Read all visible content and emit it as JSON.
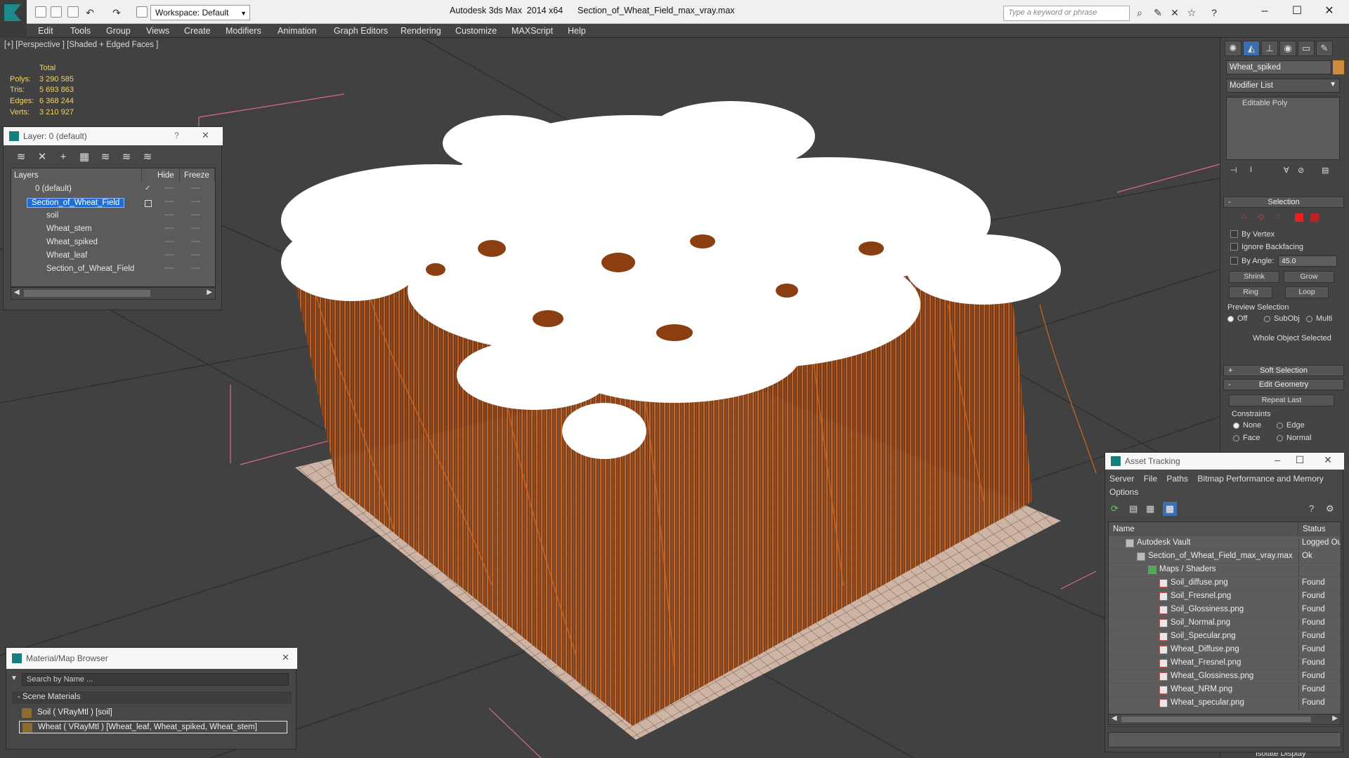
{
  "titlebar": {
    "workspace": "Workspace: Default",
    "title": "Autodesk 3ds Max  2014 x64      Section_of_Wheat_Field_max_vray.max",
    "search_placeholder": "Type a keyword or phrase"
  },
  "menu": [
    "Edit",
    "Tools",
    "Group",
    "Views",
    "Create",
    "Modifiers",
    "Animation",
    "Graph Editors",
    "Rendering",
    "Customize",
    "MAXScript",
    "Help"
  ],
  "viewport": {
    "label": "[+] [Perspective ] [Shaded + Edged Faces ]",
    "stats": {
      "total_label": "Total",
      "rows": [
        {
          "key": "Polys:",
          "value": "3 290 585"
        },
        {
          "key": "Tris:",
          "value": "5 693 863"
        },
        {
          "key": "Edges:",
          "value": "6 368 244"
        },
        {
          "key": "Verts:",
          "value": "3 210 927"
        }
      ]
    }
  },
  "layer_panel": {
    "title": "Layer: 0 (default)",
    "help": "?",
    "close": "✕",
    "columns": {
      "layers": "Layers",
      "hide": "Hide",
      "freeze": "Freeze"
    },
    "rows": [
      {
        "name": "0 (default)",
        "selected": false
      },
      {
        "name": "Section_of_Wheat_Field",
        "selected": true
      },
      {
        "name": "soil",
        "selected": false
      },
      {
        "name": "Wheat_stem",
        "selected": false
      },
      {
        "name": "Wheat_spiked",
        "selected": false
      },
      {
        "name": "Wheat_leaf",
        "selected": false
      },
      {
        "name": "Section_of_Wheat_Field",
        "selected": false
      }
    ],
    "dash": "----"
  },
  "material_browser": {
    "title": "Material/Map Browser",
    "search_placeholder": "Search by Name ...",
    "group": "- Scene Materials",
    "items": [
      {
        "label": "Soil  ( VRayMtl ) [soil]"
      },
      {
        "label": "Wheat  ( VRayMtl ) [Wheat_leaf, Wheat_spiked, Wheat_stem]"
      }
    ]
  },
  "command_panel": {
    "object_name": "Wheat_spiked",
    "modifier_list": "Modifier List",
    "stack_item": "Editable Poly",
    "selection": {
      "title": "Selection",
      "by_vertex": "By Vertex",
      "ignore_backfacing": "Ignore Backfacing",
      "by_angle": "By Angle:",
      "angle_value": "45.0",
      "shrink": "Shrink",
      "grow": "Grow",
      "ring": "Ring",
      "loop": "Loop",
      "preview_selection": "Preview Selection",
      "off": "Off",
      "subobj": "SubObj",
      "multi": "Multi",
      "status": "Whole Object Selected"
    },
    "soft_selection": "Soft Selection",
    "edit_geometry": "Edit Geometry",
    "repeat_last": "Repeat Last",
    "constraints": "Constraints",
    "none": "None",
    "edge": "Edge",
    "face": "Face",
    "normal": "Normal",
    "isolate": "Isolate Display"
  },
  "asset_tracking": {
    "title": "Asset Tracking",
    "menu": [
      "Server",
      "File",
      "Paths",
      "Bitmap Performance and Memory",
      "Options"
    ],
    "columns": {
      "name": "Name",
      "status": "Status"
    },
    "rows": [
      {
        "name": "Autodesk Vault",
        "status": "Logged Out",
        "indent": 1,
        "icon": "vault"
      },
      {
        "name": "Section_of_Wheat_Field_max_vray.max",
        "status": "Ok",
        "indent": 2,
        "icon": "max"
      },
      {
        "name": "Maps / Shaders",
        "status": "",
        "indent": 3,
        "icon": "maps"
      },
      {
        "name": "Soil_diffuse.png",
        "status": "Found",
        "indent": 4,
        "icon": "png"
      },
      {
        "name": "Soil_Fresnel.png",
        "status": "Found",
        "indent": 4,
        "icon": "png"
      },
      {
        "name": "Soil_Glossiness.png",
        "status": "Found",
        "indent": 4,
        "icon": "png"
      },
      {
        "name": "Soil_Normal.png",
        "status": "Found",
        "indent": 4,
        "icon": "png"
      },
      {
        "name": "Soil_Specular.png",
        "status": "Found",
        "indent": 4,
        "icon": "png"
      },
      {
        "name": "Wheat_Diffuse.png",
        "status": "Found",
        "indent": 4,
        "icon": "png"
      },
      {
        "name": "Wheat_Fresnel.png",
        "status": "Found",
        "indent": 4,
        "icon": "png"
      },
      {
        "name": "Wheat_Glossiness.png",
        "status": "Found",
        "indent": 4,
        "icon": "png"
      },
      {
        "name": "Wheat_NRM.png",
        "status": "Found",
        "indent": 4,
        "icon": "png"
      },
      {
        "name": "Wheat_specular.png",
        "status": "Found",
        "indent": 4,
        "icon": "png"
      }
    ]
  },
  "colors": {
    "accent": "#1e6fd1",
    "stats": "#f0d36a",
    "wheat": "#b8541a",
    "heads": "#ffffff"
  }
}
